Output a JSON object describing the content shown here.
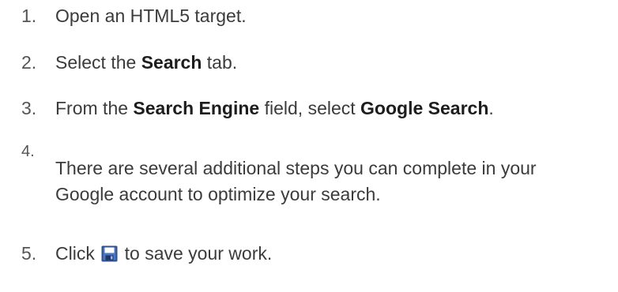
{
  "steps": [
    {
      "number": "1.",
      "text": "Open an HTML5 target."
    },
    {
      "number": "2.",
      "before": "Select the ",
      "bold": "Search",
      "after": " tab."
    },
    {
      "number": "3.",
      "before": "From the ",
      "bold1": "Search Engine",
      "middle": " field, select ",
      "bold2": "Google Search",
      "after": "."
    },
    {
      "number": "4.",
      "text": "There are several additional steps you can complete in your Google account to optimize your search."
    },
    {
      "number": "5.",
      "before": "Click ",
      "icon": "save-icon",
      "after": " to save your work."
    }
  ],
  "colors": {
    "text": "#3b3b3b",
    "bold": "#1d1d1d",
    "icon_frame": "#2f4f8f",
    "icon_fill": "#4a78c2"
  }
}
